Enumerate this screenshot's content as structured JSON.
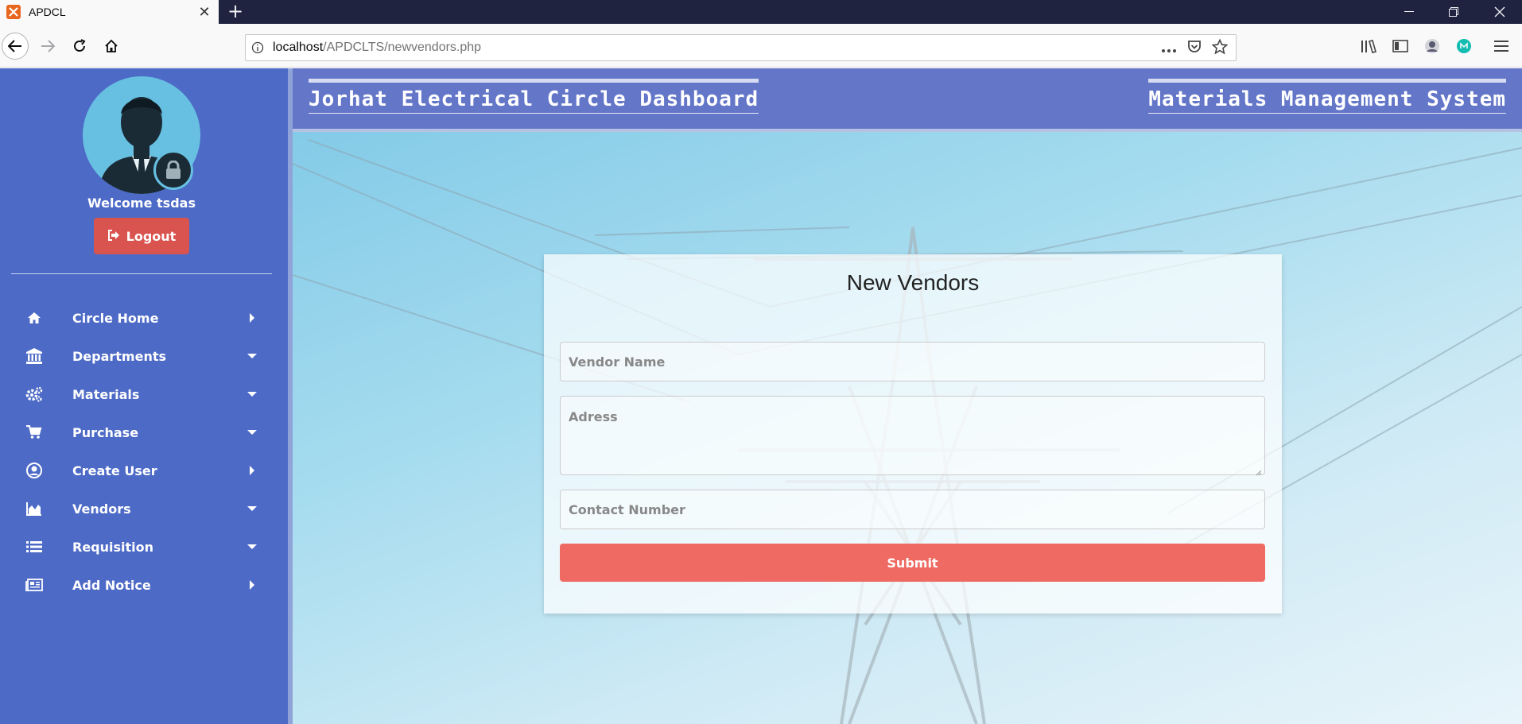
{
  "browser": {
    "tab_title": "APDCL",
    "url_host": "localhost",
    "url_path": "/APDCLTS/newvendors.php"
  },
  "header": {
    "left_title": "Jorhat Electrical Circle Dashboard",
    "right_title": "Materials Management System"
  },
  "sidebar": {
    "welcome": "Welcome tsdas",
    "logout_label": "Logout",
    "items": [
      {
        "label": "Circle Home",
        "icon": "home-icon",
        "caret": "right"
      },
      {
        "label": "Departments",
        "icon": "bank-icon",
        "caret": "down"
      },
      {
        "label": "Materials",
        "icon": "cogs-icon",
        "caret": "down"
      },
      {
        "label": "Purchase",
        "icon": "cart-icon",
        "caret": "down"
      },
      {
        "label": "Create User",
        "icon": "user-circle-icon",
        "caret": "right"
      },
      {
        "label": "Vendors",
        "icon": "area-chart-icon",
        "caret": "down"
      },
      {
        "label": "Requisition",
        "icon": "list-icon",
        "caret": "down"
      },
      {
        "label": "Add Notice",
        "icon": "newspaper-icon",
        "caret": "right"
      }
    ]
  },
  "form": {
    "title": "New Vendors",
    "vendor_name_placeholder": "Vendor Name",
    "address_placeholder": "Adress",
    "contact_placeholder": "Contact Number",
    "submit_label": "Submit"
  },
  "colors": {
    "sidebar": "#4d6ac6",
    "header": "#6376c8",
    "logout": "#d9534f",
    "submit": "#ee6a62"
  }
}
